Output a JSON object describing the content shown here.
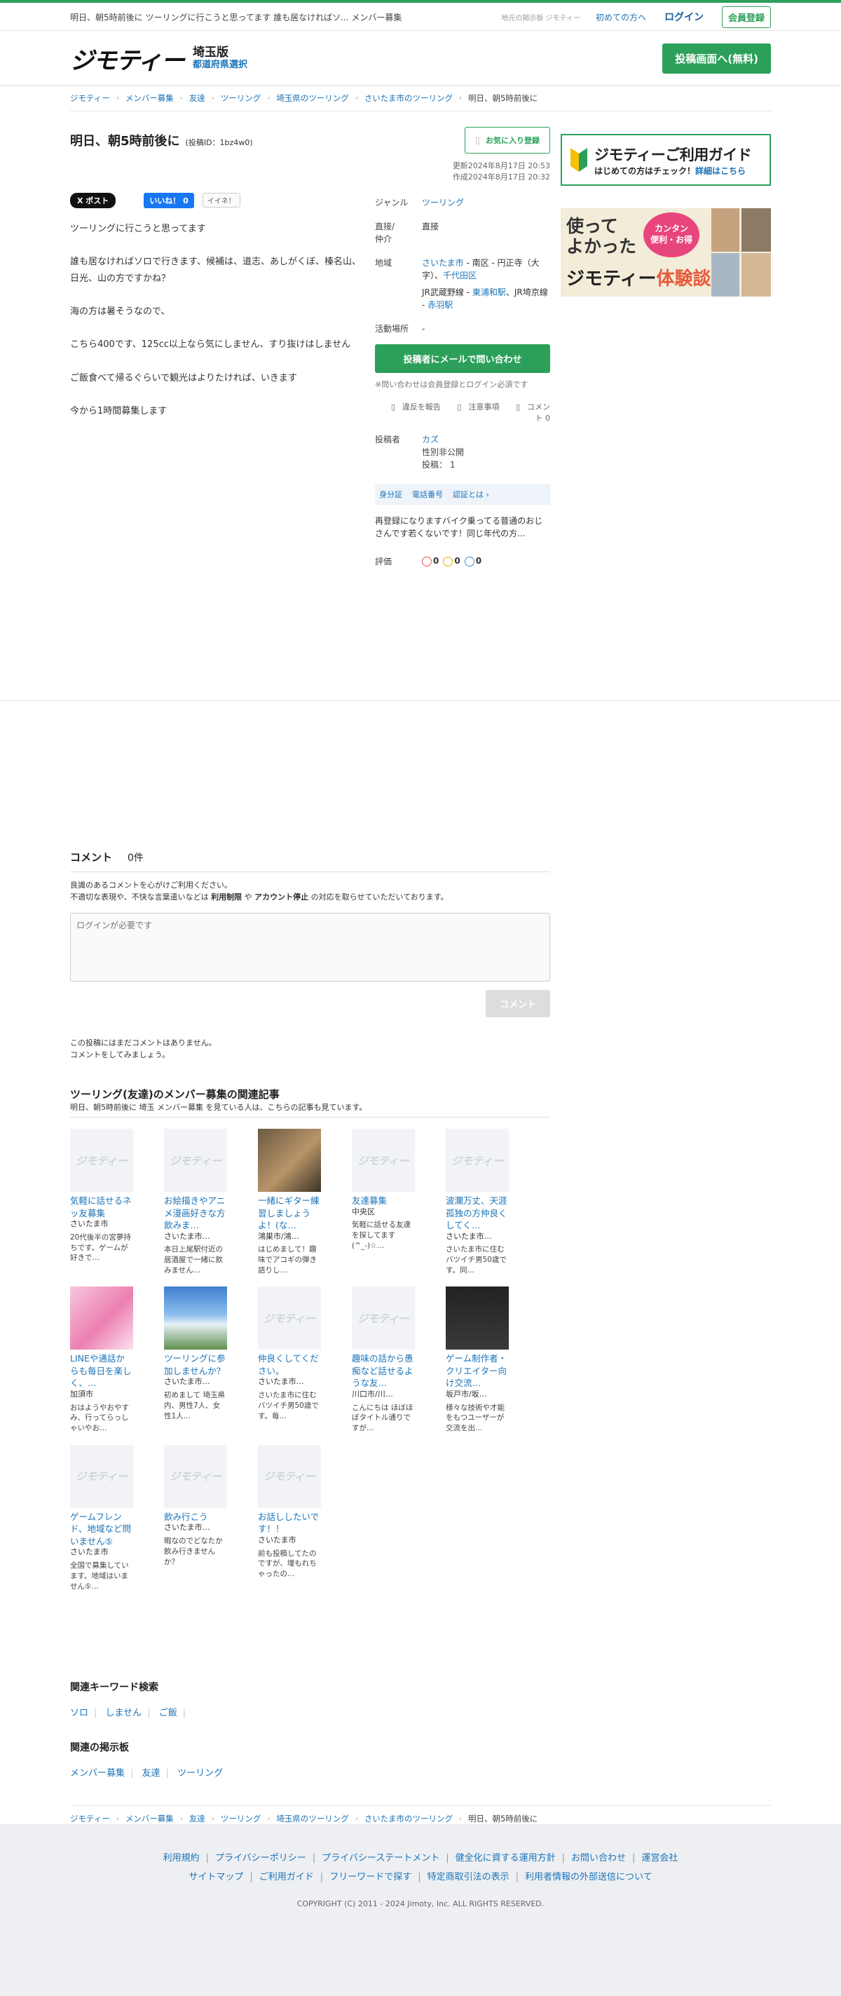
{
  "topbar": {
    "tagline": "明日、朝5時前後に ツーリングに行こうと思ってます 誰も居なければソ... メンバー募集",
    "small": "地元の掲示板 ジモティー",
    "first": "初めての方へ",
    "login": "ログイン",
    "register": "会員登録"
  },
  "header": {
    "logo": "ジモティー",
    "pref": "埼玉版",
    "select": "都道府県選択",
    "post_button": "投稿画面へ(無料)"
  },
  "breadcrumb": [
    "ジモティー",
    "メンバー募集",
    "友達",
    "ツーリング",
    "埼玉県のツーリング",
    "さいたま市のツーリング",
    "明日、朝5時前後に"
  ],
  "post": {
    "title": "明日、朝5時前後に",
    "post_id": "(投稿ID：1bz4w0)",
    "favorite": "お気に入り登録",
    "updated": "更新2024年8月17日 20:53",
    "created": "作成2024年8月17日 20:32",
    "sns_x": "X ポスト",
    "sns_fb": "いいね！ 0",
    "sns_iine": "イイネ！",
    "body": [
      "ツーリングに行こうと思ってます",
      "誰も居なければソロで行きます、候補は、道志、あしがくぼ、榛名山、日光、山の方ですかね？",
      "海の方は暑そうなので、",
      "こちら400です、125cc以上なら気にしません、すり抜けはしません",
      "ご飯食べて帰るぐらいで観光はよりたければ、いきます",
      "今から1時間募集します"
    ]
  },
  "info": {
    "genre_label": "ジャンル",
    "genre": "ツーリング",
    "direct_label_1": "直接/",
    "direct_label_2": "仲介",
    "direct": "直接",
    "area_label": "地域",
    "area_city": "さいたま市",
    "area_rest": " - 南区 - 円正寺（大字）、",
    "area_chiyoda": "千代田区",
    "line1": "JR武蔵野線 - ",
    "station1": "東浦和駅",
    "line2": "、JR埼京線 - ",
    "station2": "赤羽駅",
    "activity_label": "活動場所",
    "activity": "-",
    "contact_button": "投稿者にメールで問い合わせ",
    "note": "※問い合わせは会員登録とログイン必須です",
    "report": "違反を報告",
    "caution": "注意事項",
    "comment": "コメント 0",
    "poster_label": "投稿者",
    "poster_name": "カズ",
    "poster_gender": "性別非公開",
    "poster_posts": "投稿： 1",
    "verify_id": "身分証",
    "verify_phone": "電話番号",
    "verify_more": "認証とは ›",
    "bio": "再登録になりますバイク乗ってる普通のおじさんです若くないです！同じ年代の方...",
    "rating_label": "評価",
    "rating_good": "0",
    "rating_normal": "0",
    "rating_bad": "0"
  },
  "sidebar": {
    "guide_title": "ジモティーご利用ガイド",
    "guide_sub": "はじめての方はチェック！",
    "guide_link": "詳細はこちら",
    "exp_line1": "使って",
    "exp_line2": "よかった",
    "exp_bubble1": "カンタン",
    "exp_bubble2": "便利・お得",
    "exp_brand": "ジモティー",
    "exp_suffix": "体験談"
  },
  "comments": {
    "title": "コメント",
    "count": "0件",
    "rule1": "良識のあるコメントを心がけご利用ください。",
    "rule2a": "不適切な表現や、不快な言葉遣いなどは ",
    "rule2b": "利用制限",
    "rule2c": " や ",
    "rule2d": "アカウント停止",
    "rule2e": " の対応を取らせていただいております。",
    "placeholder": "ログインが必要です",
    "button": "コメント",
    "empty1": "この投稿にはまだコメントはありません。",
    "empty2": "コメントをしてみましょう。"
  },
  "related": {
    "title": "ツーリング(友達)のメンバー募集の関連記事",
    "sub": "明日、朝5時前後に 埼玉 メンバー募集 を見ている人は、こちらの記事も見ています。",
    "placeholder_logo": "ジモティー",
    "items": [
      {
        "title": "気軽に話せるネッ友募集",
        "loc": "さいたま市",
        "ex": "20代後半の宮夢持ちです。ゲームが好きで…"
      },
      {
        "title": "お絵描きやアニメ漫画好きな方飲みま…",
        "loc": "さいたま市…",
        "ex": "本日上尾駅付近の居酒屋で一緒に飲みません…"
      },
      {
        "title": "一緒にギター練習しましょうよ！(な…",
        "loc": "鴻巣市/鴻…",
        "ex": "はじめまして！趣味でアコギの弾き語りし…"
      },
      {
        "title": "友達󠄀募集",
        "loc": "中央区",
        "ex": "気軽に話せる友達を探してます(^_-)☆…"
      },
      {
        "title": "波瀾万丈、天涯孤独の方仲良くしてく…",
        "loc": "さいたま市…",
        "ex": "さいたま市に住むバツイチ男50歳です。同…"
      },
      {
        "title": "LINEや通話からも毎日を楽しく、…",
        "loc": "加須市",
        "ex": "おはようやおやすみ、行ってらっしゃいやお…"
      },
      {
        "title": "ツーリングに参加しませんか？",
        "loc": "さいたま市…",
        "ex": "初めまして 埼玉県内、男性7人、女性1人…"
      },
      {
        "title": "仲良くしてください。",
        "loc": "さいたま市…",
        "ex": "さいたま市に住むバツイチ男50歳です。毎…"
      },
      {
        "title": "趣味の話から愚痴など話せるような友…",
        "loc": "川口市/川…",
        "ex": "こんにちは ほぼほぼタイトル通りですが…"
      },
      {
        "title": "ゲーム制作者・クリエイター向け交流…",
        "loc": "坂戸市/坂…",
        "ex": "様々な技術や才能をもつユーザーが交流を出…"
      },
      {
        "title": "ゲームフレンド、地域など問いません⑤",
        "loc": "さいたま市",
        "ex": "全国で募集しています。地域はいません⑤…"
      },
      {
        "title": "飲み行こう󠄀",
        "loc": "さいたま市…",
        "ex": "暇なのでどなたか飲み行きませんか？"
      },
      {
        "title": "お話ししたいです！！",
        "loc": "さいたま市",
        "ex": "前も投稿してたのですが、埋もれちゃったの…"
      }
    ]
  },
  "keywords": {
    "title": "関連キーワード検索",
    "items": [
      "ソロ",
      "しません",
      "ご飯"
    ]
  },
  "boards": {
    "title": "関連の掲示板",
    "items": [
      "メンバー募集",
      "友達",
      "ツーリング"
    ]
  },
  "footer": {
    "row1": [
      "利用規約",
      "プライバシーポリシー",
      "プライバシーステートメント",
      "健全化に資する運用方針",
      "お問い合わせ",
      "運営会社"
    ],
    "row2": [
      "サイトマップ",
      "ご利用ガイド",
      "フリーワードで探す",
      "特定商取引法の表示",
      "利用者情報の外部送信について"
    ],
    "copyright": "COPYRIGHT (C) 2011 - 2024 Jimoty, Inc. ALL RIGHTS RESERVED."
  }
}
